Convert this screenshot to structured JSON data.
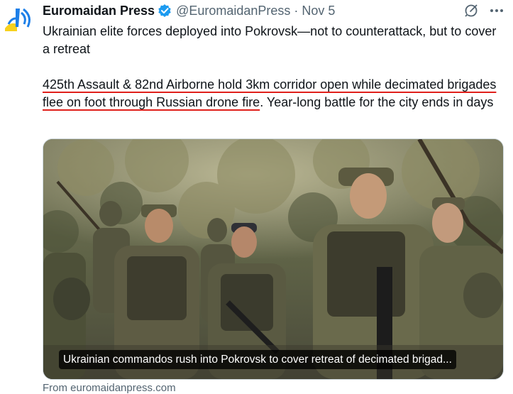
{
  "tweet": {
    "author_name": "Euromaidan Press",
    "handle": "@EuromaidanPress",
    "separator": "·",
    "date": "Nov 5",
    "paragraph1": "Ukrainian elite forces deployed into Pokrovsk—not to counterattack, but to cover a retreat",
    "paragraph2_underlined": "425th Assault & 82nd Airborne hold 3km corridor open while decimated brigades flee on foot through Russian drone fire",
    "paragraph2_rest": ". Year-long battle for the city ends in days",
    "media_caption": "Ukrainian commandos rush into Pokrovsk to cover retreat of decimated brigad...",
    "source": "From euromaidanpress.com"
  },
  "icons": {
    "verified": "verified-badge-icon",
    "grok": "grok-icon",
    "more": "more-icon"
  },
  "colors": {
    "underline": "#e0201b",
    "verified": "#1d9bf0",
    "logo_blue": "#1d7fe8",
    "logo_yellow": "#f7d11e",
    "secondary_text": "#536471"
  }
}
